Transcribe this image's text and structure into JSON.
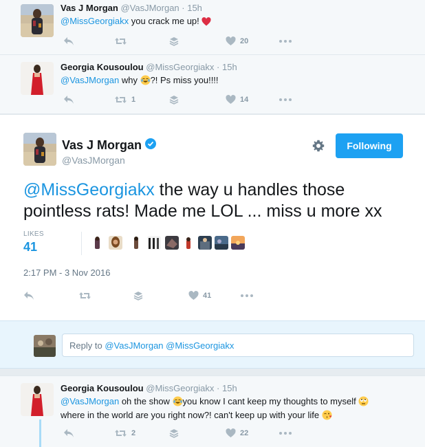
{
  "tweets_above": [
    {
      "name": "Vas J Morgan",
      "handle": "@VasJMorgan",
      "time": "· 15h",
      "mention": "@MissGeorgiakx",
      "text": " you crack me up! ",
      "emoji": "red-heart",
      "retweets": "",
      "likes": "20"
    },
    {
      "name": "Georgia Kousoulou",
      "handle": "@MissGeorgiakx",
      "time": "· 15h",
      "mention": "@VasJMorgan",
      "text_before": " why ",
      "emoji": "tears-of-joy",
      "text_after": "?! Ps miss you!!!!",
      "retweets": "1",
      "likes": "14"
    }
  ],
  "main_tweet": {
    "name": "Vas J Morgan",
    "handle": "@VasJMorgan",
    "follow_label": "Following",
    "mention": "@MissGeorgiakx",
    "text": " the way u handles those pointless rats! Made me LOL ... miss u more xx",
    "likes_label": "LIKES",
    "likes_count": "41",
    "timestamp": "2:17 PM - 3 Nov 2016",
    "action_likes": "41"
  },
  "reply_box": {
    "prefix": "Reply to ",
    "mentions": "@VasJMorgan @MissGeorgiakx"
  },
  "tweet_below": {
    "name": "Georgia Kousoulou",
    "handle": "@MissGeorgiakx",
    "time": "· 15h",
    "mention": "@VasJMorgan",
    "line1_a": " oh the show ",
    "line1_b": "you know I cant keep my thoughts to myself ",
    "line2": "where in the world are you right now?! can't keep up with your life ",
    "retweets": "2",
    "likes": "22"
  },
  "icons": [
    "reply-icon",
    "retweet-icon",
    "buffer-icon",
    "heart-icon",
    "more-icon",
    "gear-icon",
    "verified-icon"
  ],
  "colors": {
    "accent": "#1da1f2",
    "link": "#1b95e0",
    "muted": "#8899a6",
    "heart": "#e0245e"
  }
}
